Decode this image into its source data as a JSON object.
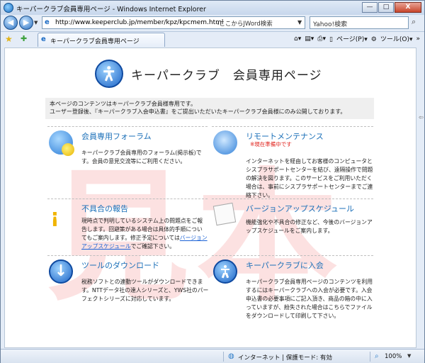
{
  "window": {
    "title": "キーパークラブ会員専用ページ - Windows Internet Explorer",
    "controls": {
      "minimize": "—",
      "maximize": "□",
      "close": "X"
    }
  },
  "address_bar": {
    "url": "http://www.keeperclub.jp/member/kpz/kpcmem.html",
    "search_hint": "‹ここからJWord検索",
    "search_placeholder": "Yahoo!検索"
  },
  "tab": {
    "label": "キーパークラブ会員専用ページ"
  },
  "command_bar": {
    "page_menu": "ページ(P)",
    "tools_menu": "ツール(O)"
  },
  "page": {
    "title": "キーパークラブ　会員専用ページ",
    "intro_line1": "本ページのコンテンツはキーパークラブ会員様専用です。",
    "intro_line2": "ユーザー登録後、『キーパークラブ入会申込書』をご提出いただいたキーパークラブ会員様にのみ公開しております。",
    "watermark": "見本",
    "items": [
      {
        "title": "会員専用フォーラム",
        "desc": "キーパークラブ会員専用のフォーラム(掲示板)です。会員の意見交流等にご利用ください。",
        "icon": "forum-smiley-icon"
      },
      {
        "title": "リモートメンテナンス",
        "note": "※現在準備中です",
        "desc": "インターネットを経由してお客様のコンピュータとシスプラサポートセンターを結び、遠隔操作で問題の解決を図ります。このサービスをご利用いただく場合は、事前にシスプラサポートセンターまでご連絡下さい。",
        "icon": "remote-maintenance-icon"
      },
      {
        "title": "不具合の報告",
        "desc_before_link": "現時点で判明しているシステム上の問題点をご報告します。回避策がある場合は具体的手順についてもご案内します。修正予定については",
        "link": "バージョンアップスケジュール",
        "desc_after_link": "でご確認下さい。",
        "icon": "bug-report-icon"
      },
      {
        "title": "バージョンアップスケジュール",
        "desc": "機能強化や不具合の修正など、今後のバージョンアップスケジュールをご案内します。",
        "icon": "schedule-icon"
      },
      {
        "title": "ツールのダウンロード",
        "desc": "税務ソフトとの連動ツールがダウンロードできます。NTTデータ社の達人シリーズと、YWS社のパーフェクトシリーズに対応しています。",
        "icon": "download-icon"
      },
      {
        "title": "キーパークラブに入会",
        "desc": "キーパークラブ会員専用ページのコンテンツを利用するにはキーパークラブへの入会が必要です。入会申込書の必要事項にご記入頂き、商品の箱の中に入っていますが、紛失された場合はこちらでファイルをダウンロードして印刷して下さい。",
        "icon": "join-icon"
      }
    ]
  },
  "status_bar": {
    "zone": "インターネット | 保護モード: 有効",
    "zoom": "100%"
  }
}
